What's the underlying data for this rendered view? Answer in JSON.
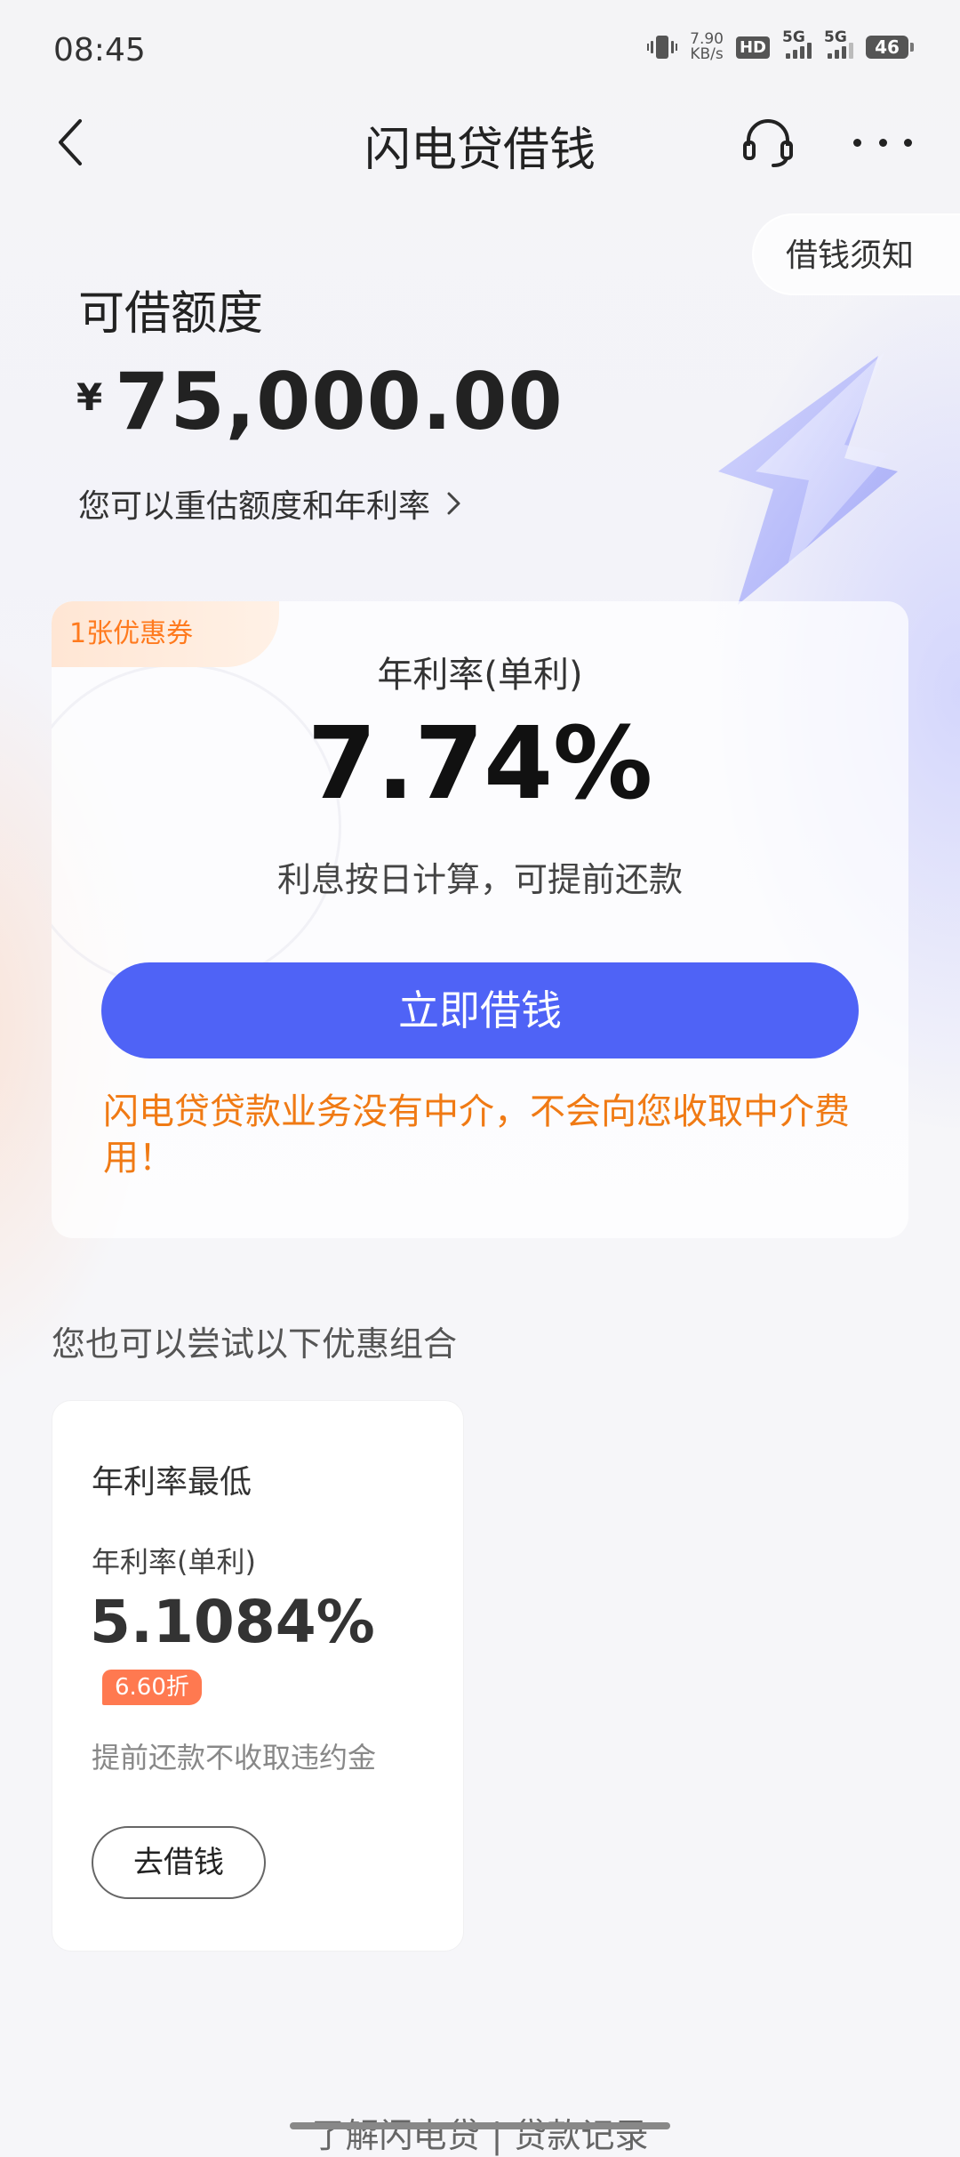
{
  "status_bar": {
    "time": "08:45",
    "net_speed_value": "7.90",
    "net_speed_unit": "KB/s",
    "hd_label": "HD",
    "sim1_label": "5G",
    "sim2_label": "5G",
    "battery": "46"
  },
  "nav": {
    "back_icon": "chevron-left-icon",
    "title": "闪电贷借钱",
    "service_icon": "headset-icon",
    "more_icon": "more-dots-icon"
  },
  "notice": {
    "label": "借钱须知"
  },
  "quota": {
    "label": "可借额度",
    "currency": "¥",
    "amount": "75,000.00",
    "reassess_text": "您可以重估额度和年利率"
  },
  "main_card": {
    "coupon_tag": "1张优惠券",
    "rate_label": "年利率(单利)",
    "rate_value": "7.74%",
    "rate_desc": "利息按日计算，可提前还款",
    "borrow_button": "立即借钱",
    "warning": "闪电贷贷款业务没有中介，不会向您收取中介费用！"
  },
  "combos": {
    "section_title": "您也可以尝试以下优惠组合",
    "items": [
      {
        "name": "年利率最低",
        "rate_label": "年利率(单利)",
        "rate": "5.1084%",
        "discount": "6.60折",
        "note": "提前还款不收取违约金",
        "button": "去借钱"
      }
    ]
  },
  "footer": {
    "links": "了解闪电贷 | 贷款记录"
  },
  "colors": {
    "accent": "#4f63f6",
    "warning": "#f07a14",
    "coupon": "#ff7a1e",
    "discount_badge": "#ff7950"
  }
}
